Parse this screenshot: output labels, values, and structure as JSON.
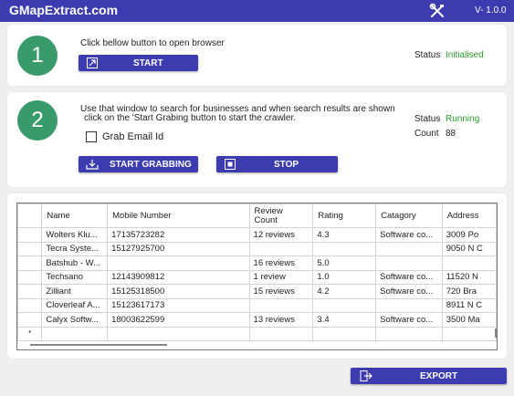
{
  "app": {
    "title": "GMapExtract.com",
    "version": "V- 1.0.0",
    "tools_icon": "tools-icon"
  },
  "step1": {
    "number": "1",
    "instruction": "Click bellow button to open browser",
    "start_label": "START",
    "start_icon": "external-link-icon",
    "status_label": "Status",
    "status_value": "Initialised"
  },
  "step2": {
    "number": "2",
    "instruction_line1": "Use that window to search for businesses and when search results are shown",
    "instruction_line2": "click on the 'Start Grabing button to start the crawler.",
    "grab_email_label": "Grab Email Id",
    "grab_email_checked": false,
    "start_grabbing_label": "START GRABBING",
    "start_grabbing_icon": "download-tray-icon",
    "stop_label": "STOP",
    "stop_icon": "stop-icon",
    "status_label": "Status",
    "status_value": "Running",
    "count_label": "Count",
    "count_value": "88"
  },
  "grid": {
    "columns": [
      "Name",
      "Mobile Number",
      "Review Count",
      "Rating",
      "Catagory",
      "Address"
    ],
    "rows": [
      [
        "Wolters Klu...",
        "17135723282",
        "12 reviews",
        "4.3",
        "Software co...",
        "3009 Po"
      ],
      [
        "Tecra Syste...",
        "15127925700",
        "",
        "",
        "",
        "9050 N C"
      ],
      [
        "Batshub - W...",
        "",
        "16 reviews",
        "5.0",
        "",
        ""
      ],
      [
        "Techsano",
        "12143909812",
        "1 review",
        "1.0",
        "Software co...",
        "11520 N"
      ],
      [
        "Zilliant",
        "15125318500",
        "15 reviews",
        "4.2",
        "Software co...",
        "720 Bra"
      ],
      [
        "Cloverleaf A...",
        "15123617173",
        "",
        "",
        "",
        "8911 N C"
      ],
      [
        "Calyx Softw...",
        "18003622599",
        "13 reviews",
        "3.4",
        "Software co...",
        "3500 Ma"
      ]
    ],
    "new_row_marker": "*"
  },
  "export": {
    "label": "EXPORT",
    "icon": "export-icon"
  },
  "colors": {
    "primary": "#3c3cb0",
    "step_circle": "#3a9b6a",
    "status_green": "#2a9a2a",
    "background": "#efeff1"
  }
}
